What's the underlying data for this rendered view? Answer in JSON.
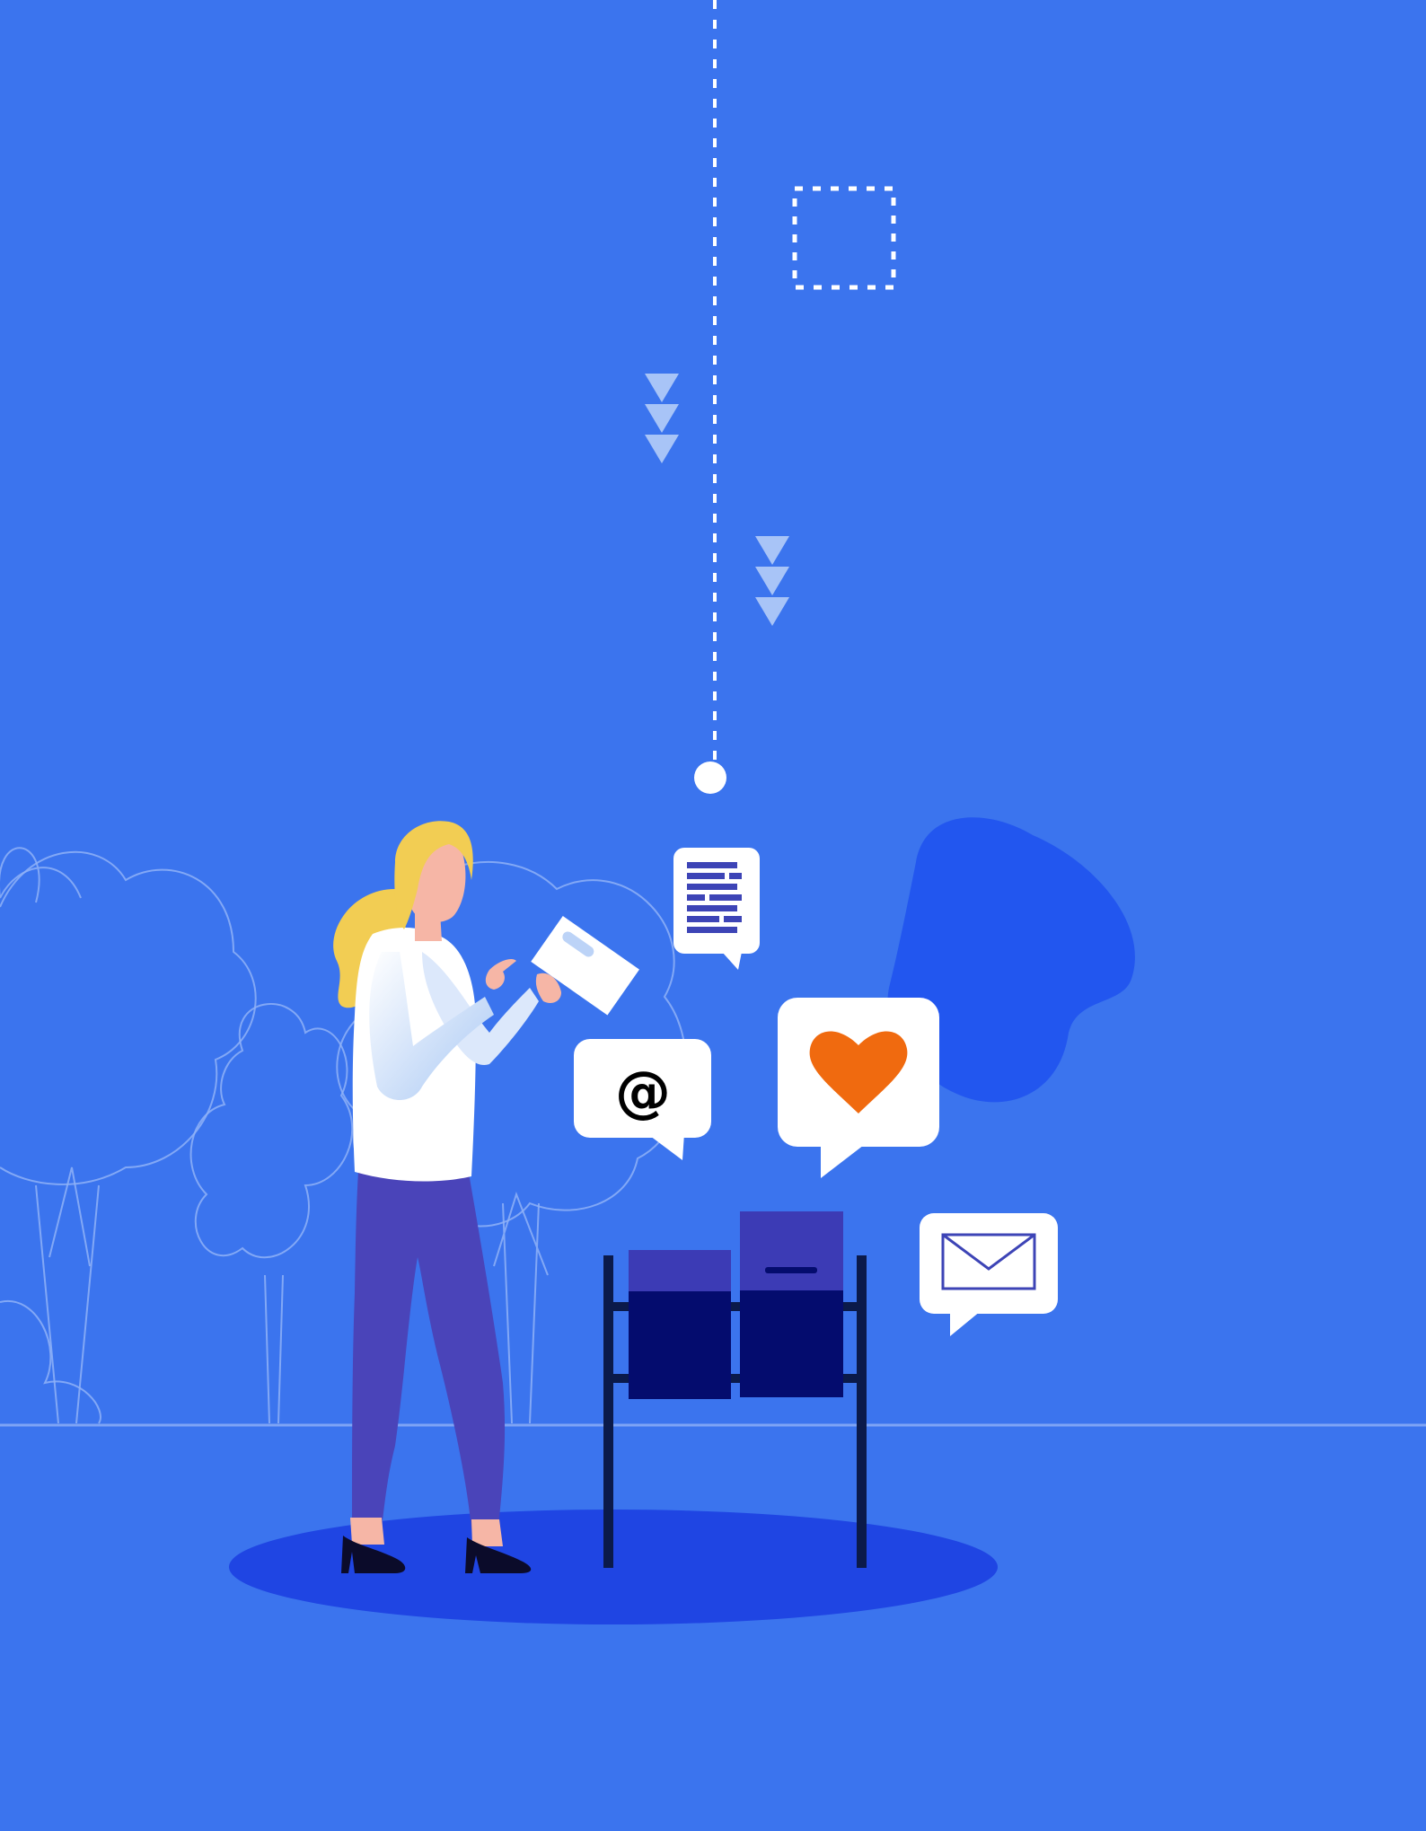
{
  "scene": {
    "description_alt": "",
    "colors": {
      "background": "#3b74ee",
      "ground_shadow": "#1f45e3",
      "tree_outline": "#8fb1f7",
      "blob": "#2256ef",
      "bubble": "#ffffff",
      "heart": "#f06a0f",
      "mailbox_dark": "#040c6e",
      "mailbox_lid": "#3c3bb5",
      "stand": "#0b1a4a",
      "hair": "#f2cd53",
      "skin": "#f6b6a6",
      "shirt": "#ffffff",
      "pants": "#4a44b9",
      "shoes": "#0b0b2a",
      "arrows": "#a8c4f7"
    },
    "bubbles": {
      "email_at_symbol": "@"
    },
    "icons": [
      "document-bubble-icon",
      "at-sign-bubble-icon",
      "heart-bubble-icon",
      "envelope-bubble-icon",
      "down-arrows-icon"
    ]
  }
}
